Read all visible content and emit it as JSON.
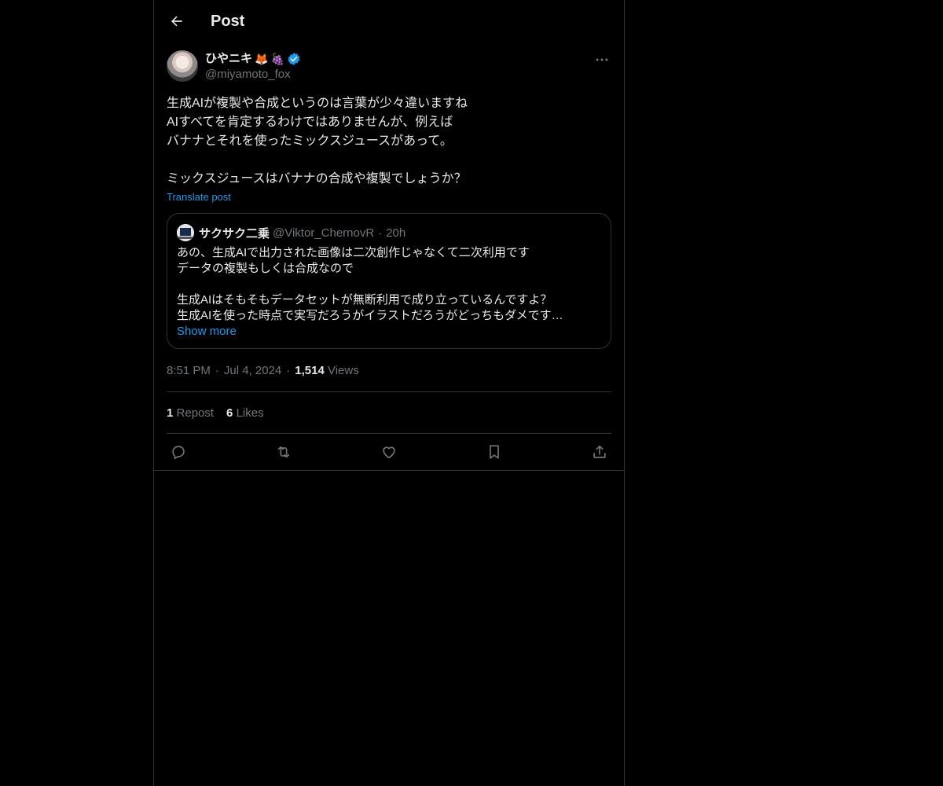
{
  "header": {
    "title": "Post",
    "back_icon": "arrow-left-icon"
  },
  "post": {
    "author": {
      "display_name": "ひやニキ",
      "emojis": [
        "🦊",
        "🍇"
      ],
      "handle": "@miyamoto_fox",
      "verified": true,
      "verified_color": "#1d9bf0"
    },
    "text": "生成AIが複製や合成というのは言葉が少々違いますね\nAIすべてを肯定するわけではありませんが、例えば\nバナナとそれを使ったミックスジュースがあって。\n\nミックスジュースはバナナの合成や複製でしょうか？",
    "translate_label": "Translate post",
    "quote": {
      "display_name": "サクサク二乗",
      "handle": "@Viktor_ChernovR",
      "time": "20h",
      "text": "あの、生成AIで出力された画像は二次創作じゃなくて二次利用です\nデータの複製もしくは合成なので\n\n生成AIはそもそもデータセットが無断利用で成り立っているんですよ？\n生成AIを使った時点で実写だろうがイラストだろうがどっちもダメです…",
      "show_more": "Show more"
    },
    "meta": {
      "time": "8:51 PM",
      "date": "Jul 4, 2024",
      "views_count": "1,514",
      "views_label": "Views"
    },
    "stats": {
      "reposts_count": "1",
      "reposts_label": "Repost",
      "likes_count": "6",
      "likes_label": "Likes"
    },
    "actions": [
      "reply-icon",
      "repost-icon",
      "like-icon",
      "bookmark-icon",
      "share-icon"
    ]
  },
  "colors": {
    "background": "#000000",
    "text": "#e7e9ea",
    "secondary": "#71767b",
    "accent": "#1d9bf0",
    "border": "#2f3336"
  }
}
